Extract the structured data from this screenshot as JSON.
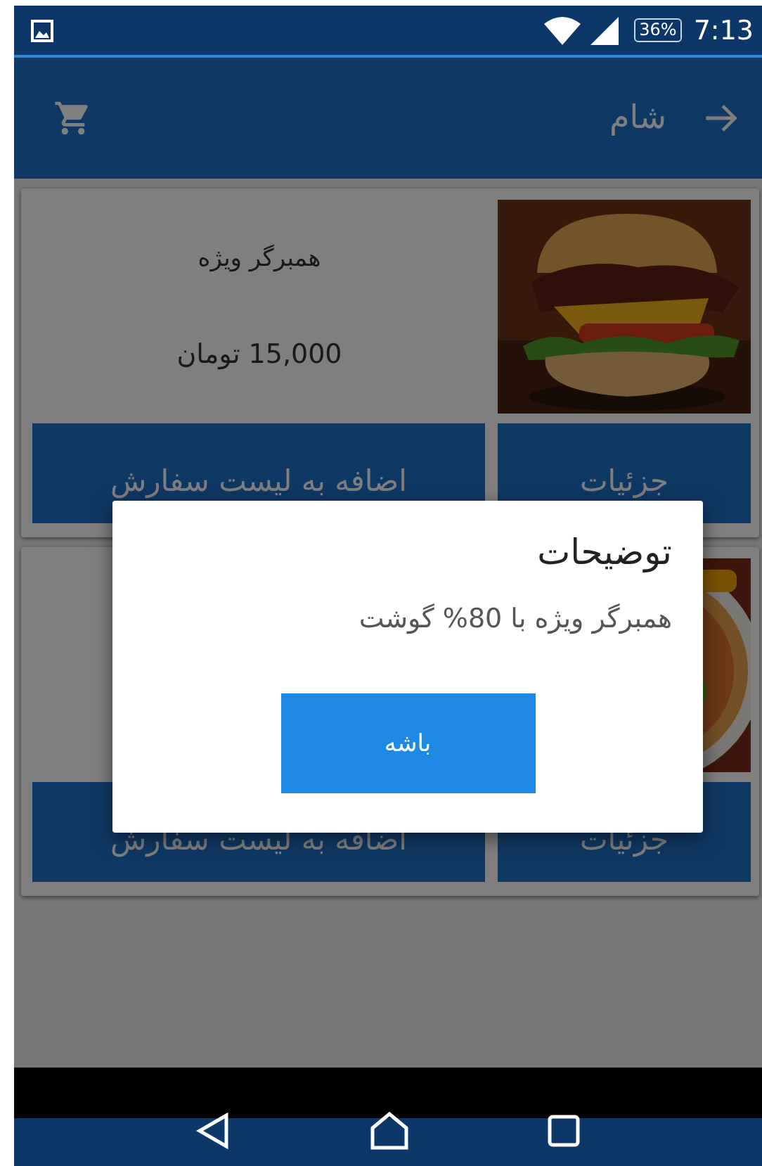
{
  "status_bar": {
    "battery": "36%",
    "time": "7:13"
  },
  "app_bar": {
    "title": "شام"
  },
  "products": [
    {
      "name": "همبرگر ویژه",
      "price": "15,000 تومان",
      "details_button": "جزئیات",
      "order_button": "اضافه به لیست سفارش"
    },
    {
      "details_button": "جزئیات",
      "order_button": "اضافه به لیست سفارش"
    }
  ],
  "dialog": {
    "title": "توضیحات",
    "message": "همبرگر ویژه با 80% گوشت",
    "button": "باشه"
  }
}
